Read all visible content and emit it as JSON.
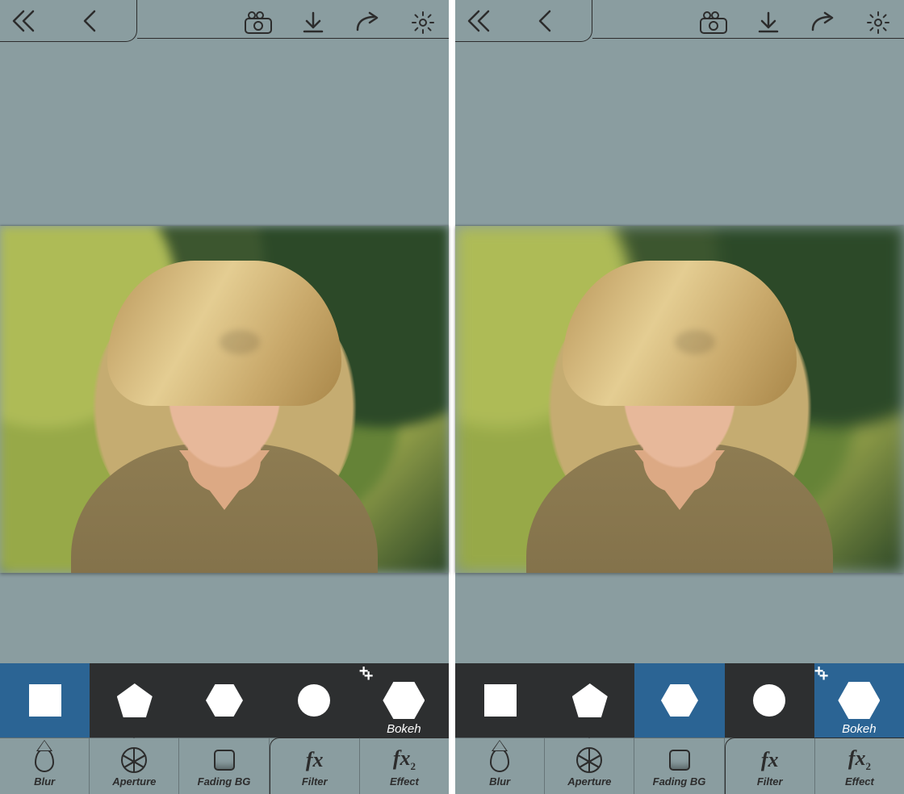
{
  "top_icons": {
    "double_back": "double-chevron-left-icon",
    "back": "chevron-left-icon",
    "camera": "camera-icon",
    "download": "download-icon",
    "share": "share-icon",
    "settings": "gear-icon"
  },
  "shape_strip": {
    "bokeh_label": "Bokeh",
    "shapes": [
      "square",
      "pentagon",
      "hexagon",
      "circle",
      "big-hexagon"
    ]
  },
  "tabs": {
    "blur": "Blur",
    "aperture": "Aperture",
    "fading_bg": "Fading BG",
    "filter": "Filter",
    "effect": "Effect",
    "fx_symbol": "fx",
    "fx2_sub": "2",
    "active": "aperture"
  },
  "left_screen": {
    "selected_shape_index": 0
  },
  "right_screen": {
    "selected_shape_index": 2,
    "also_selected_index": 4
  },
  "colors": {
    "accent": "#2b6494",
    "toolbar": "#2d2f30",
    "bg": "#8a9da0"
  }
}
